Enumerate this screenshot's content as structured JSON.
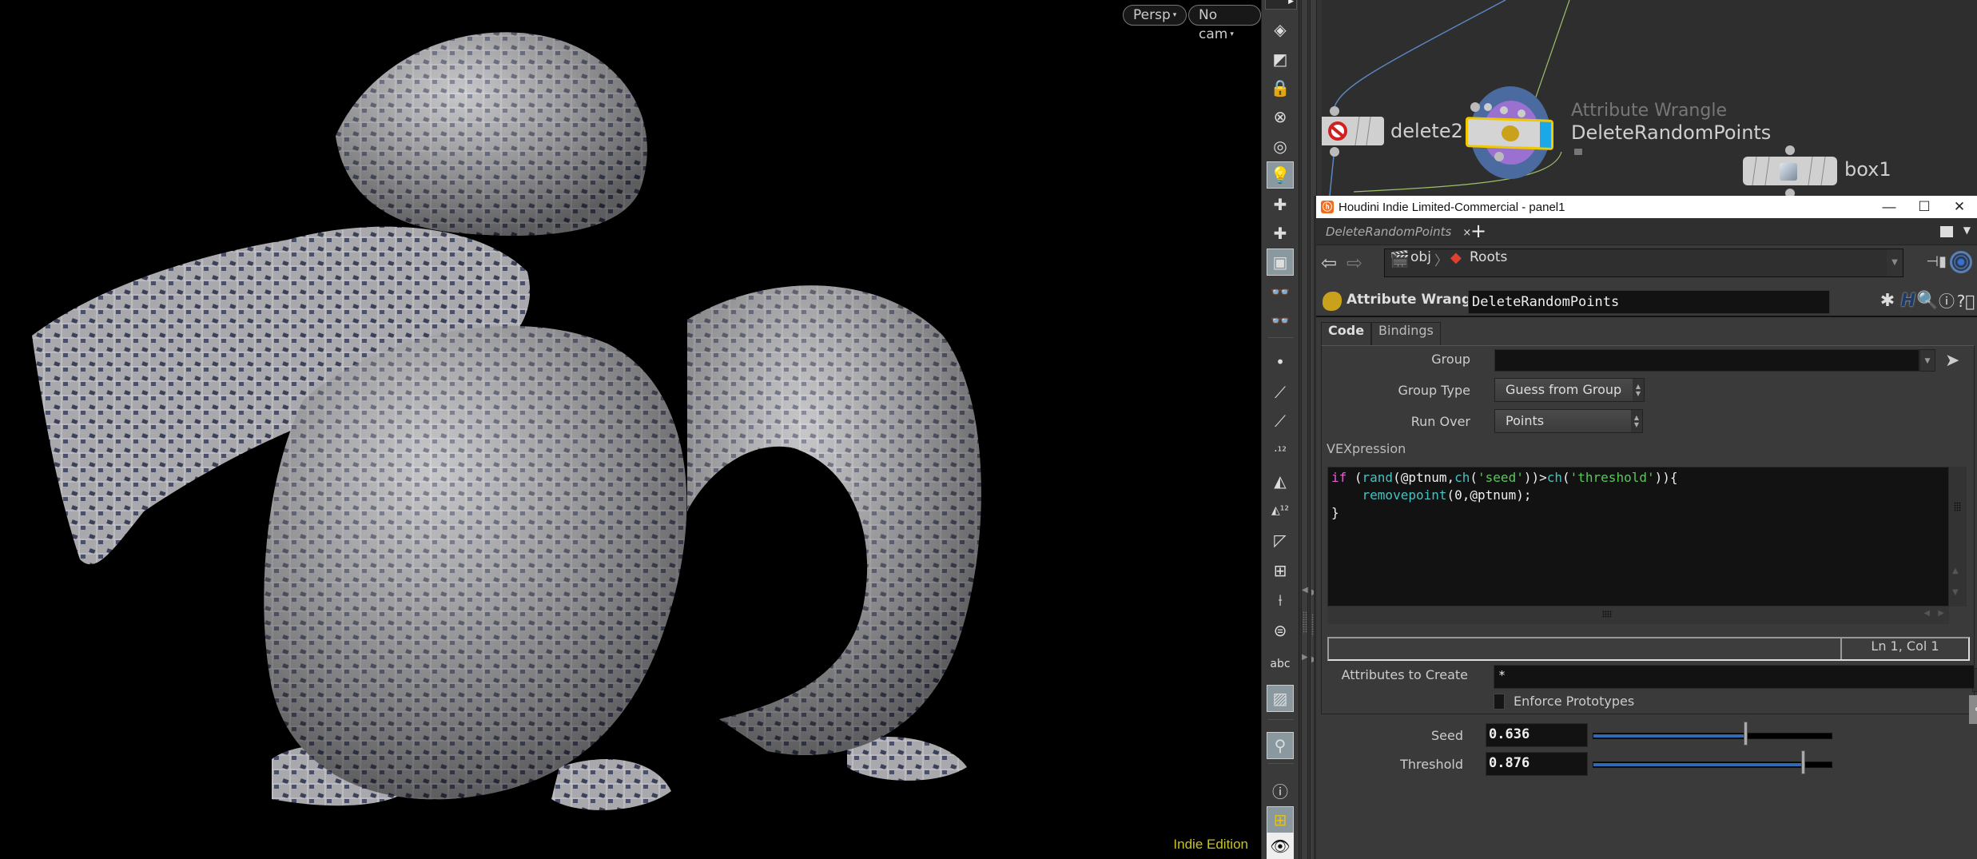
{
  "viewport": {
    "view_menu": "Persp",
    "camera_menu": "No cam",
    "edition_label": "Indie Edition"
  },
  "shelf": {
    "tools": [
      {
        "name": "display-options-icon",
        "glyph": "◈"
      },
      {
        "name": "snapping-icon",
        "glyph": "◩"
      },
      {
        "name": "lock-icon",
        "glyph": "🔒"
      },
      {
        "name": "no-lights-icon",
        "glyph": "⊗"
      },
      {
        "name": "headlight-icon",
        "glyph": "◎"
      },
      {
        "name": "normal-lighting-icon",
        "glyph": "💡"
      },
      {
        "name": "high-quality-lighting-icon",
        "glyph": "✚"
      },
      {
        "name": "shadows-icon",
        "glyph": "✚"
      },
      {
        "name": "ambient-occlusion-icon",
        "glyph": "▣"
      },
      {
        "name": "stereo-glasses-icon",
        "glyph": "👓"
      },
      {
        "name": "stereo-camera-icon",
        "glyph": "👓"
      },
      {
        "name": "point-display-icon",
        "glyph": "•"
      },
      {
        "name": "point-normals-icon",
        "glyph": "⟋"
      },
      {
        "name": "point-trails-icon",
        "glyph": "⟋"
      },
      {
        "name": "point-numbers-icon",
        "glyph": "·¹²"
      },
      {
        "name": "primitive-normals-icon",
        "glyph": "◭"
      },
      {
        "name": "primitive-numbers-icon",
        "glyph": "◭¹²"
      },
      {
        "name": "hull-display-icon",
        "glyph": "◸"
      },
      {
        "name": "uv-display-icon",
        "glyph": "⊞"
      },
      {
        "name": "vertex-display-icon",
        "glyph": "⟊"
      },
      {
        "name": "background-image-icon",
        "glyph": "⊜"
      },
      {
        "name": "text-annotation-icon",
        "glyph": "abc"
      },
      {
        "name": "reference-image-icon",
        "glyph": "▨"
      },
      {
        "name": "marker-pin-icon",
        "glyph": "⚲"
      },
      {
        "name": "info-icon",
        "glyph": "ⓘ"
      },
      {
        "name": "grid-icon",
        "glyph": "⊞"
      },
      {
        "name": "visibility-eye-icon",
        "glyph": "👁"
      }
    ]
  },
  "network": {
    "nodes": [
      {
        "name": "delete2"
      },
      {
        "name": "DeleteRandomPoints",
        "type": "Attribute Wrangle"
      },
      {
        "name": "box1"
      }
    ]
  },
  "window": {
    "title": "Houdini Indie Limited-Commercial - panel1",
    "minimize": "—",
    "maximize": "☐",
    "close": "✕"
  },
  "tabbar": {
    "tab_label": "DeleteRandomPoints",
    "close_glyph": "×",
    "add_glyph": "+"
  },
  "pathbar": {
    "crumbs": [
      "obj",
      "Roots"
    ]
  },
  "operator": {
    "type_label": "Attribute Wrangle",
    "node_name": "DeleteRandomPoints"
  },
  "param_tabs": [
    "Code",
    "Bindings"
  ],
  "params": {
    "group_label": "Group",
    "group_value": "",
    "group_type_label": "Group Type",
    "group_type_value": "Guess from Group",
    "run_over_label": "Run Over",
    "run_over_value": "Points",
    "vexpression_label": "VEXpression",
    "code_lines": [
      "if (rand(@ptnum,ch('seed'))>ch('threshold')){",
      "    removepoint(0,@ptnum);",
      "}"
    ],
    "cursor_position": "Ln 1, Col 1",
    "attributes_label": "Attributes to Create",
    "attributes_value": "*",
    "enforce_prototypes_label": "Enforce Prototypes",
    "enforce_prototypes_checked": false
  },
  "spare_params": {
    "seed_label": "Seed",
    "seed_value": "0.636",
    "seed_fraction": 0.636,
    "threshold_label": "Threshold",
    "threshold_value": "0.876",
    "threshold_fraction": 0.876
  },
  "colors": {
    "wrangle_node_ring": "#4a6aa0",
    "wrangle_node_inner": "#9a70d0",
    "selected_outline": "#f0c800",
    "display_flag": "#1aa8e8",
    "slider_fill": "#2e6bb3",
    "vex_keyword": "#e060d0",
    "vex_function": "#4ac0c0",
    "vex_string": "#5ac85a",
    "indie_label": "#c6c22a"
  }
}
